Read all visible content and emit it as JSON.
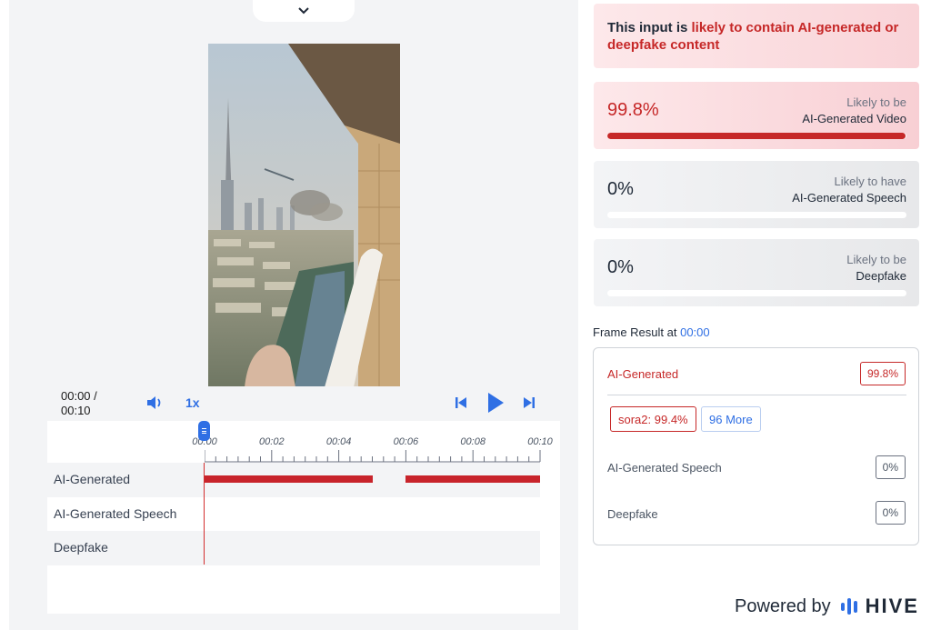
{
  "player": {
    "time_current": "00:00 /",
    "time_total": "00:10",
    "speed": "1x",
    "timeline_ticks": [
      "00:00",
      "00:02",
      "00:04",
      "00:06",
      "00:08",
      "00:10"
    ],
    "tracks": [
      {
        "label": "AI-Generated",
        "segments": [
          [
            0,
            5.0
          ],
          [
            6.0,
            10
          ]
        ]
      },
      {
        "label": "AI-Generated Speech",
        "segments": []
      },
      {
        "label": "Deepfake",
        "segments": []
      }
    ],
    "duration_seconds": 10
  },
  "summary": {
    "banner_prefix": "This input is ",
    "banner_highlight": "likely to contain AI-generated or deepfake content"
  },
  "cards": [
    {
      "percent": "99.8%",
      "value": 0.998,
      "caption_line1": "Likely to be",
      "caption_line2": "AI-Generated Video",
      "tone": "red"
    },
    {
      "percent": "0%",
      "value": 0,
      "caption_line1": "Likely to have",
      "caption_line2": "AI-Generated Speech",
      "tone": "gray"
    },
    {
      "percent": "0%",
      "value": 0,
      "caption_line1": "Likely to be",
      "caption_line2": "Deepfake",
      "tone": "gray"
    }
  ],
  "frame_result": {
    "heading": "Frame Result at ",
    "timestamp": "00:00",
    "ai_generated_label": "AI-Generated",
    "ai_generated_value": "99.8%",
    "source_chip": "sora2: 99.4%",
    "more_chip": "96 More",
    "speech_label": "AI-Generated Speech",
    "speech_value": "0%",
    "deepfake_label": "Deepfake",
    "deepfake_value": "0%"
  },
  "footer": {
    "powered_by": "Powered by",
    "brand": "HIVE"
  },
  "colors": {
    "accent": "#2f6fe4",
    "alert": "#c62828"
  }
}
